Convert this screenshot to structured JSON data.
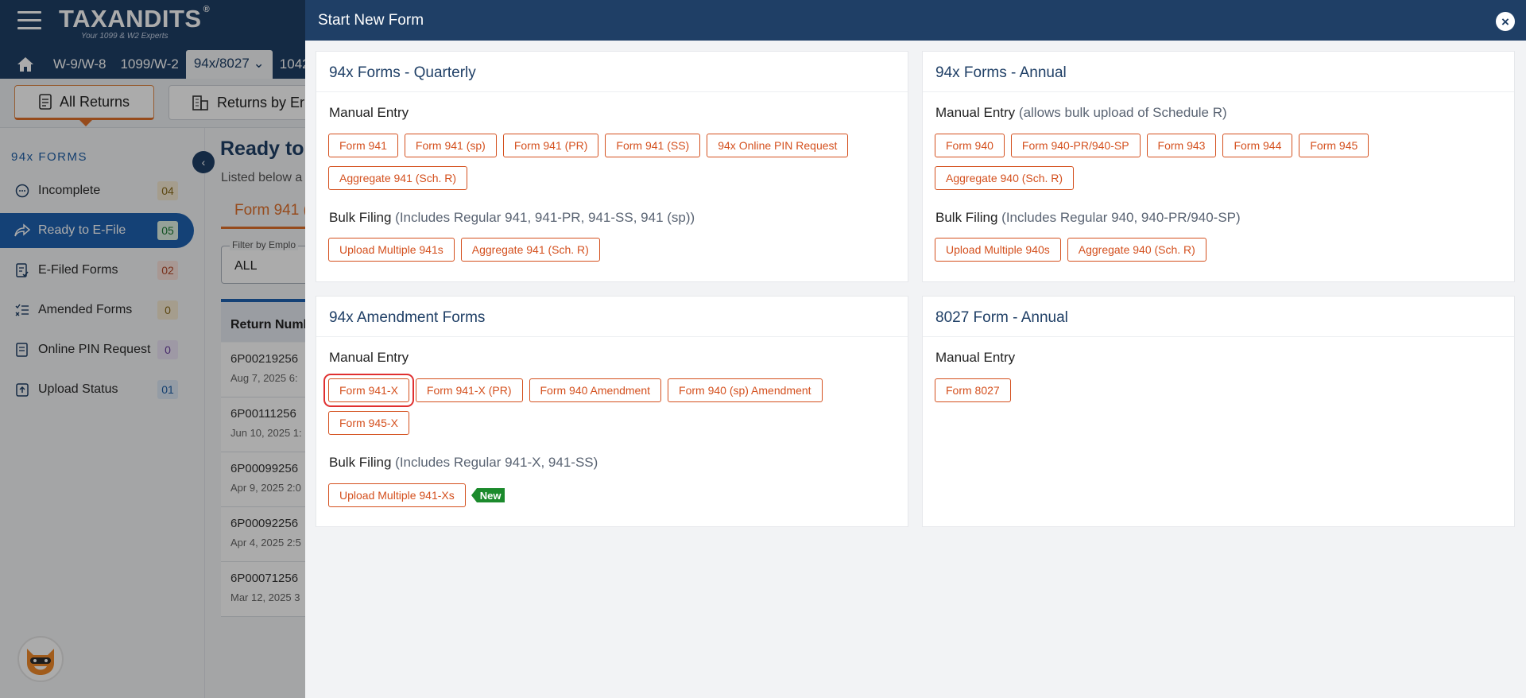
{
  "app": {
    "logo_text": "TAXANDITS",
    "logo_tagline": "Your 1099 & W2 Experts",
    "nav_tabs": [
      "W-9/W-8",
      "1099/W-2",
      "94x/8027",
      "1042"
    ],
    "active_tab": "94x/8027"
  },
  "subnav": {
    "all_returns": "All Returns",
    "returns_by_employer": "Returns by Er"
  },
  "sidebar": {
    "heading": "94x FORMS",
    "items": [
      {
        "label": "Incomplete",
        "count": "04",
        "icon": "clock-dots-icon"
      },
      {
        "label": "Ready to E-File",
        "count": "05",
        "icon": "share-arrow-icon"
      },
      {
        "label": "E-Filed Forms",
        "count": "02",
        "icon": "checklist-icon"
      },
      {
        "label": "Amended Forms",
        "count": "0",
        "icon": "list-check-icon"
      },
      {
        "label": "Online PIN Request",
        "count": "0",
        "icon": "pin-doc-icon"
      },
      {
        "label": "Upload Status",
        "count": "01",
        "icon": "upload-icon"
      }
    ]
  },
  "main": {
    "title": "Ready to E",
    "subtitle": "Listed below a",
    "form_tab": "Form 941 (",
    "filter_label": "Filter by Emplo",
    "filter_value": "ALL",
    "table_header": "Return Numb",
    "rows": [
      {
        "id": "6P00219256",
        "date": "Aug 7, 2025 6:"
      },
      {
        "id": "6P00111256",
        "date": "Jun 10, 2025 1:"
      },
      {
        "id": "6P00099256",
        "date": "Apr 9, 2025 2:0"
      },
      {
        "id": "6P00092256",
        "date": "Apr 4, 2025 2:5"
      },
      {
        "id": "6P00071256",
        "date": "Mar 12, 2025 3"
      }
    ]
  },
  "modal": {
    "title": "Start New Form",
    "cards": {
      "quarterly": {
        "title": "94x Forms - Quarterly",
        "manual_label": "Manual Entry",
        "manual_buttons": [
          "Form 941",
          "Form 941 (sp)",
          "Form 941 (PR)",
          "Form 941 (SS)",
          "94x Online PIN Request",
          "Aggregate 941 (Sch. R)"
        ],
        "bulk_label": "Bulk Filing",
        "bulk_note": "(Includes Regular 941, 941-PR, 941-SS, 941 (sp))",
        "bulk_buttons": [
          "Upload Multiple 941s",
          "Aggregate 941 (Sch. R)"
        ]
      },
      "annual": {
        "title": "94x Forms - Annual",
        "manual_label": "Manual Entry",
        "manual_note": "(allows bulk upload of Schedule R)",
        "manual_buttons": [
          "Form 940",
          "Form 940-PR/940-SP",
          "Form 943",
          "Form 944",
          "Form 945",
          "Aggregate 940 (Sch. R)"
        ],
        "bulk_label": "Bulk Filing",
        "bulk_note": "(Includes Regular 940, 940-PR/940-SP)",
        "bulk_buttons": [
          "Upload Multiple 940s",
          "Aggregate 940 (Sch. R)"
        ]
      },
      "amendment": {
        "title": "94x Amendment Forms",
        "manual_label": "Manual Entry",
        "manual_buttons": [
          "Form 941-X",
          "Form 941-X (PR)",
          "Form 940 Amendment",
          "Form 940 (sp) Amendment",
          "Form 945-X"
        ],
        "bulk_label": "Bulk Filing",
        "bulk_note": "(Includes Regular 941-X, 941-SS)",
        "bulk_buttons": [
          "Upload Multiple 941-Xs"
        ],
        "new_badge": "New"
      },
      "form8027": {
        "title": "8027 Form - Annual",
        "manual_label": "Manual Entry",
        "manual_buttons": [
          "Form 8027"
        ]
      }
    }
  },
  "colors": {
    "navy": "#1f3f66",
    "accent_orange": "#d4501e",
    "active_blue": "#1f62b0",
    "new_green": "#1b8a2c",
    "highlight_red": "#e03030"
  }
}
